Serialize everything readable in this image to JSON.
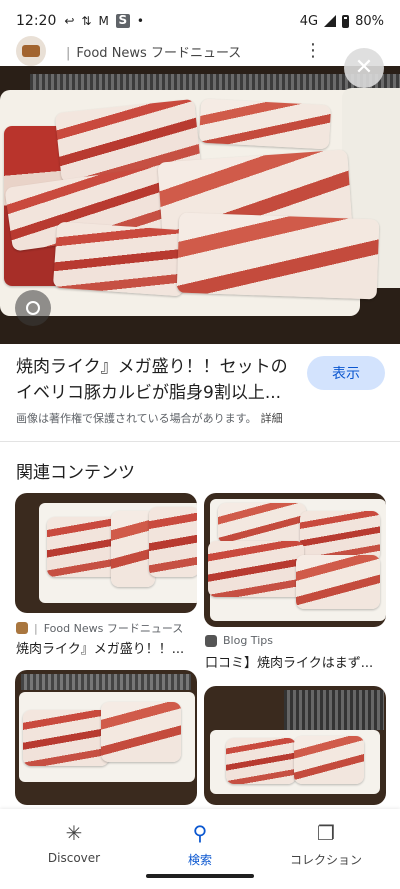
{
  "status_bar": {
    "time": "12:20",
    "network": "4G",
    "battery": "80%",
    "icons": [
      "back-arrow-icon",
      "sync-icon",
      "gmail-icon",
      "s-app-icon",
      "dot-icon"
    ]
  },
  "source": {
    "name": "Food News フードニュース"
  },
  "result": {
    "title": "焼肉ライク』メガ盛り！！セットのイベリコ豚カルビが脂身9割以上...",
    "show_button": "表示",
    "notice": "画像は著作権で保護されている場合があります。",
    "notice_detail": "詳細"
  },
  "related": {
    "heading": "関連コンテンツ",
    "items": [
      {
        "source": "Food News フードニュース",
        "title": "焼肉ライク』メガ盛り！！..."
      },
      {
        "source": "Blog Tips",
        "title": "口コミ】焼肉ライクはまず..."
      }
    ]
  },
  "nav": {
    "items": [
      {
        "label": "Discover",
        "icon": "asterisk-icon"
      },
      {
        "label": "検索",
        "icon": "search-icon"
      },
      {
        "label": "コレクション",
        "icon": "collections-icon"
      }
    ],
    "active": "検索"
  },
  "colors": {
    "accent": "#0b57d0",
    "pill_bg": "#d3e3fd"
  }
}
